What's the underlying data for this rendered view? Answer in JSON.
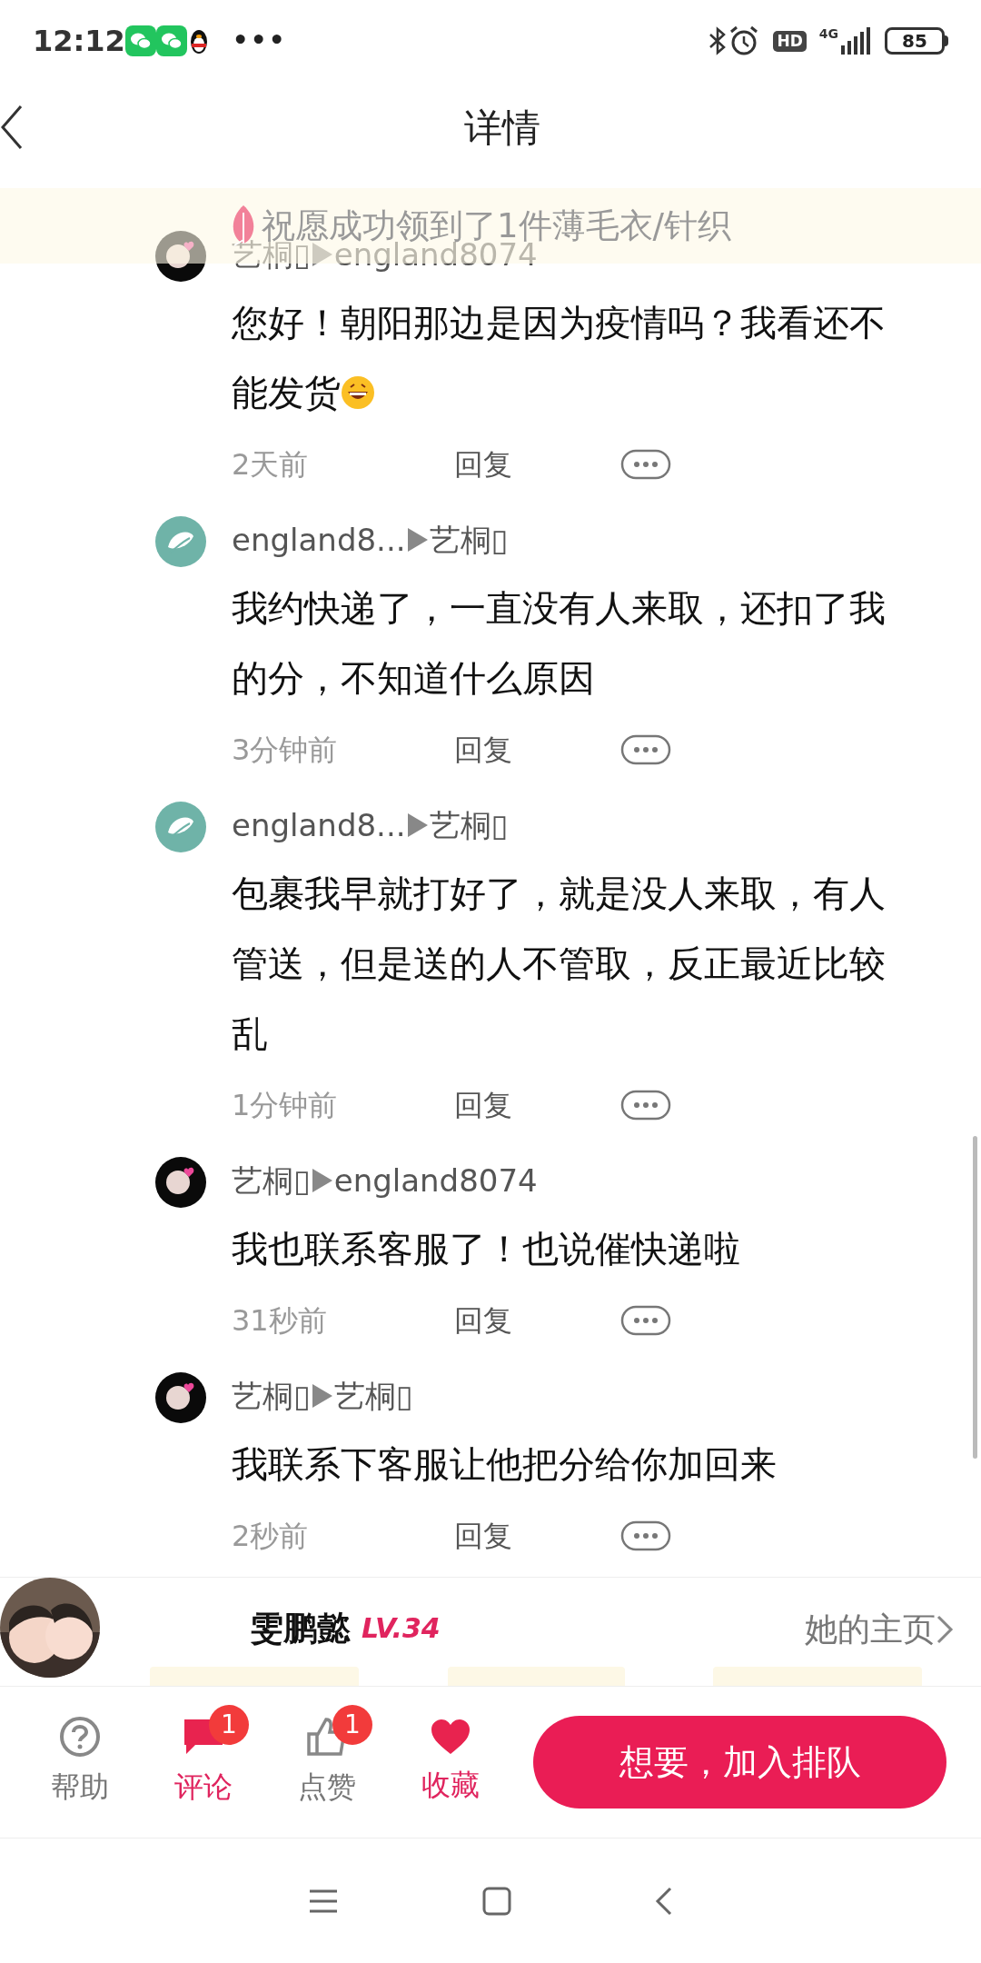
{
  "status_bar": {
    "time": "12:12",
    "more": "•••",
    "hd": "HD",
    "network": "4G",
    "battery": "85"
  },
  "header": {
    "title": "详情"
  },
  "banner": {
    "text": "祝愿成功领到了1件薄毛衣/针织"
  },
  "comments": [
    {
      "author": "艺桐▯",
      "reply_to": "england8074",
      "lines": [
        "您好！朝阳那边是因为疫情吗？我看还不",
        "能发货"
      ],
      "emoji": true,
      "time": "2天前",
      "reply": "回复"
    },
    {
      "kind": "leaf",
      "author": "england8...",
      "reply_to": "艺桐▯",
      "lines": [
        "我约快递了，一直没有人来取，还扣了我",
        "的分，不知道什么原因"
      ],
      "emoji": false,
      "time": "3分钟前",
      "reply": "回复"
    },
    {
      "kind": "leaf",
      "author": "england8...",
      "reply_to": "艺桐▯",
      "lines": [
        "包裹我早就打好了，就是没人来取，有人",
        "管送，但是送的人不管取，反正最近比较",
        "乱"
      ],
      "emoji": false,
      "time": "1分钟前",
      "reply": "回复"
    },
    {
      "author": "艺桐▯",
      "reply_to": "england8074",
      "lines": [
        "我也联系客服了！也说催快递啦"
      ],
      "emoji": false,
      "time": "31秒前",
      "reply": "回复"
    },
    {
      "author": "艺桐▯",
      "reply_to": "艺桐▯",
      "lines": [
        "我联系下客服让他把分给你加回来"
      ],
      "emoji": false,
      "time": "2秒前",
      "reply": "回复"
    }
  ],
  "profile": {
    "name": "雯鹏懿",
    "level": "LV.34",
    "home_link": "她的主页"
  },
  "bottom_bar": {
    "items": [
      {
        "kind": "help",
        "label": "帮助",
        "active": false
      },
      {
        "kind": "comment",
        "label": "评论",
        "active": true,
        "badge": "1"
      },
      {
        "kind": "like",
        "label": "点赞",
        "active": false,
        "badge": "1"
      },
      {
        "kind": "favorite",
        "label": "收藏",
        "active": true
      }
    ],
    "button": "想要，加入排队"
  }
}
